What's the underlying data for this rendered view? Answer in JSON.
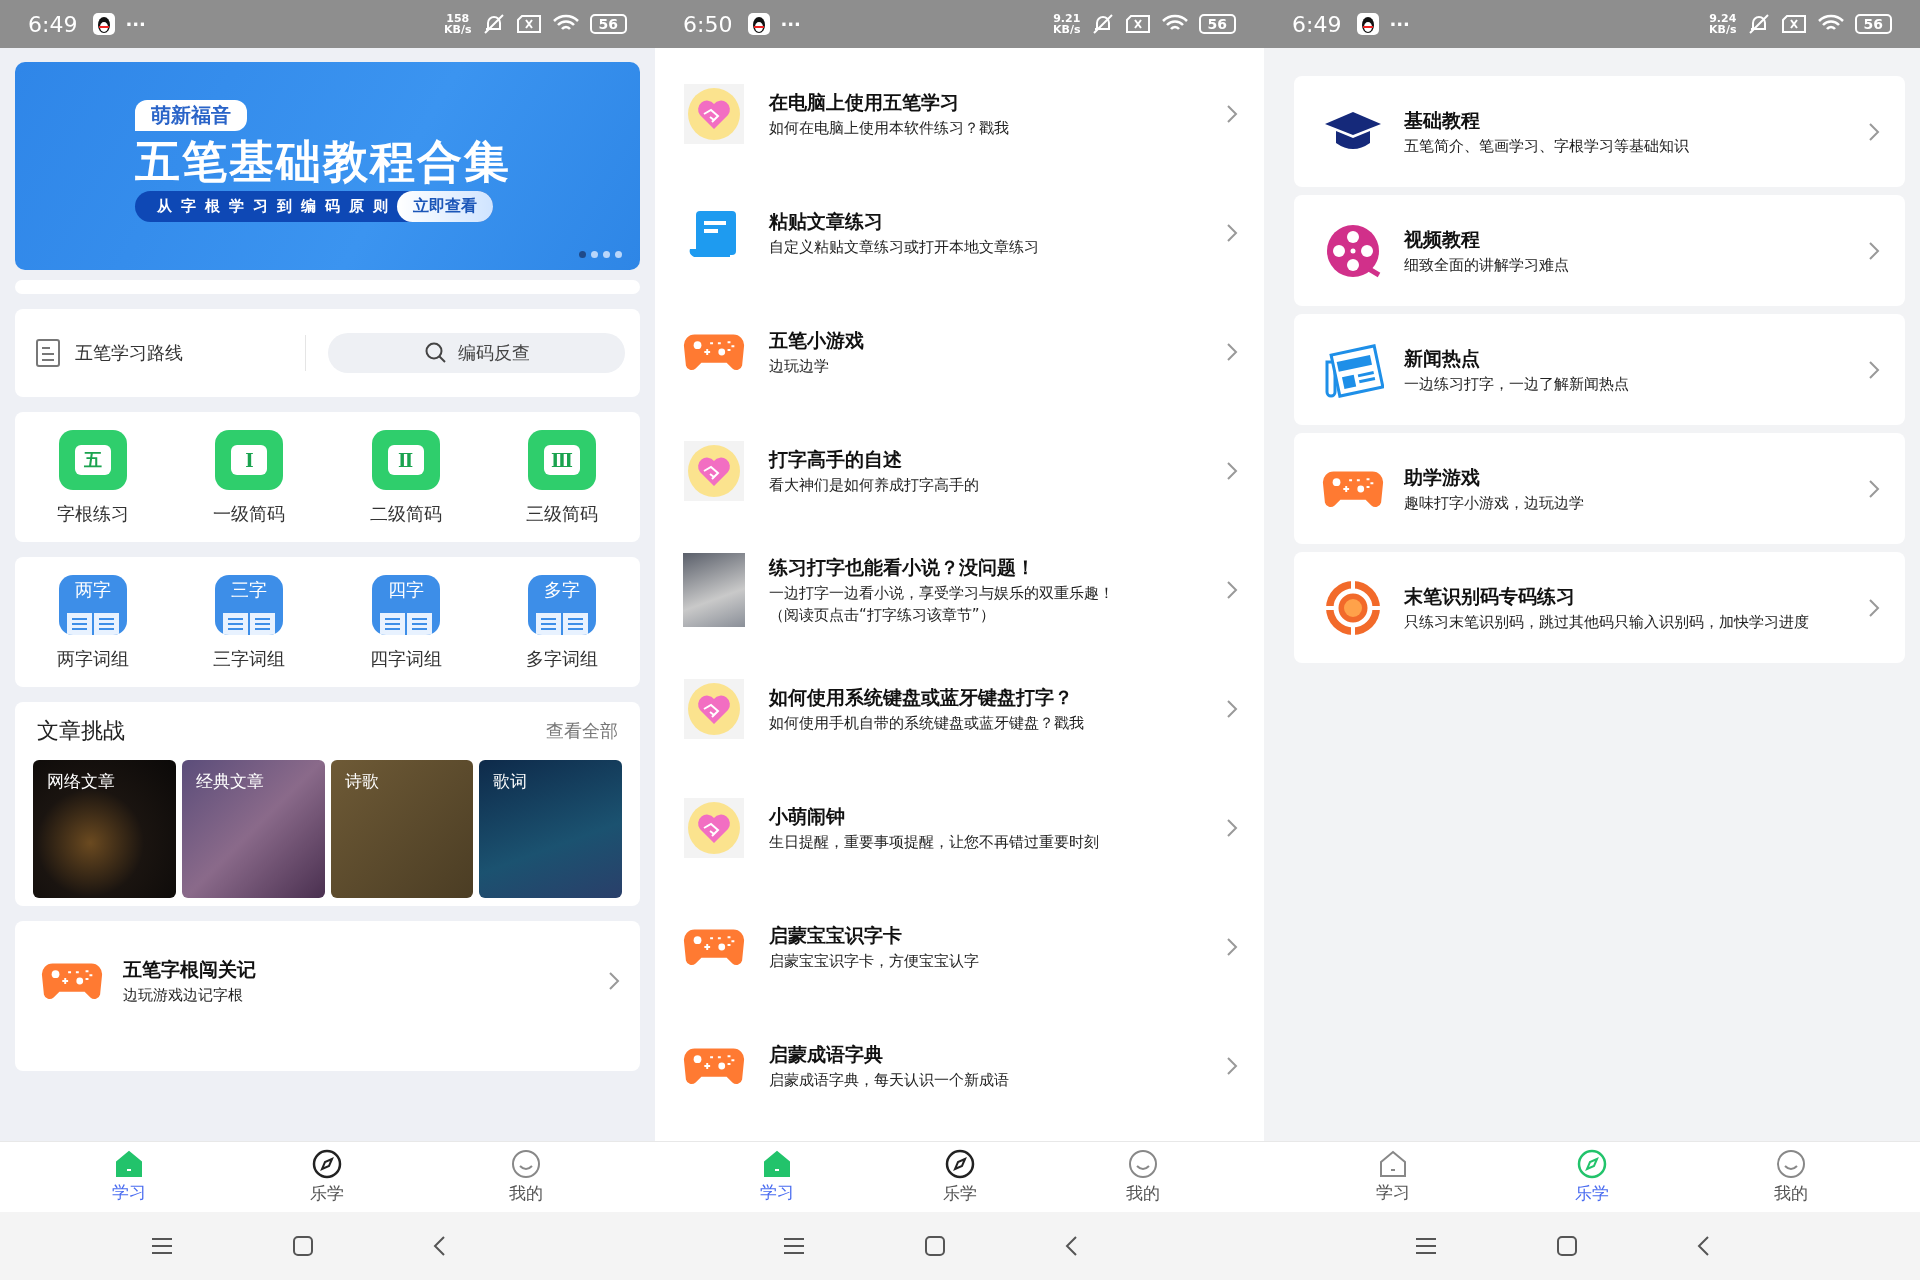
{
  "screens": [
    {
      "kind": "home",
      "status_bar": {
        "time": "6:49",
        "more": "···",
        "speed": "158",
        "speed_unit": "KB/s",
        "battery": "56"
      },
      "banner": {
        "tag": "萌新福音",
        "title": "五笔基础教程合集",
        "subtitle": "从字根学习到编码原则",
        "button": "立即查看",
        "dots": [
          {
            "selected": true
          },
          {
            "selected": false
          },
          {
            "selected": false
          },
          {
            "selected": false
          }
        ]
      },
      "route_link": "五笔学习路线",
      "search": {
        "placeholder": "编码反查"
      },
      "basics": [
        {
          "glyph": "五",
          "label": "字根练习"
        },
        {
          "glyph": "Ⅰ",
          "label": "一级简码"
        },
        {
          "glyph": "Ⅱ",
          "label": "二级简码"
        },
        {
          "glyph": "Ⅲ",
          "label": "三级简码"
        }
      ],
      "phrases": [
        {
          "tile": "两字",
          "label": "两字词组"
        },
        {
          "tile": "三字",
          "label": "三字词组"
        },
        {
          "tile": "四字",
          "label": "四字词组"
        },
        {
          "tile": "多字",
          "label": "多字词组"
        }
      ],
      "articles": {
        "title": "文章挑战",
        "more": "查看全部",
        "cards": [
          {
            "label": "网络文章"
          },
          {
            "label": "经典文章"
          },
          {
            "label": "诗歌"
          },
          {
            "label": "歌词"
          }
        ]
      },
      "items": [
        {
          "kind": "gamepad",
          "title": "五笔字根闯关记",
          "subtitle": "边玩游戏边记字根"
        }
      ],
      "tabs": [
        {
          "kind": "home",
          "label": "学习",
          "selected": true
        },
        {
          "kind": "compass",
          "label": "乐学",
          "selected": false
        },
        {
          "kind": "face",
          "label": "我的",
          "selected": false
        }
      ]
    },
    {
      "kind": "list",
      "status_bar": {
        "time": "6:50",
        "more": "···",
        "speed": "9.21",
        "speed_unit": "KB/s",
        "battery": "56"
      },
      "items": [
        {
          "kind": "heart",
          "title": "在电脑上使用五笔学习",
          "subtitle": "如何在电脑上使用本软件练习？戳我"
        },
        {
          "kind": "scroll",
          "title": "粘贴文章练习",
          "subtitle": "自定义粘贴文章练习或打开本地文章练习"
        },
        {
          "kind": "gamepad",
          "title": "五笔小游戏",
          "subtitle": "边玩边学"
        },
        {
          "kind": "heart",
          "title": "打字高手的自述",
          "subtitle": "看大神们是如何养成打字高手的"
        },
        {
          "kind": "cover",
          "title": "练习打字也能看小说？没问题！",
          "subtitle": "一边打字一边看小说，享受学习与娱乐的双重乐趣！",
          "subtitle_2": "（阅读页点击“打字练习该章节”）"
        },
        {
          "kind": "heart",
          "title": "如何使用系统键盘或蓝牙键盘打字？",
          "subtitle": "如何使用手机自带的系统键盘或蓝牙键盘？戳我"
        },
        {
          "kind": "heart",
          "title": "小萌闹钟",
          "subtitle": "生日提醒，重要事项提醒，让您不再错过重要时刻"
        },
        {
          "kind": "gamepad",
          "title": "启蒙宝宝识字卡",
          "subtitle": "启蒙宝宝识字卡，方便宝宝认字"
        },
        {
          "kind": "gamepad",
          "title": "启蒙成语字典",
          "subtitle": "启蒙成语字典，每天认识一个新成语"
        }
      ],
      "tabs": [
        {
          "kind": "home",
          "label": "学习",
          "selected": true
        },
        {
          "kind": "compass",
          "label": "乐学",
          "selected": false
        },
        {
          "kind": "face",
          "label": "我的",
          "selected": false
        }
      ]
    },
    {
      "kind": "cards",
      "status_bar": {
        "time": "6:49",
        "more": "···",
        "speed": "9.24",
        "speed_unit": "KB/s",
        "battery": "56"
      },
      "items": [
        {
          "kind": "cap",
          "title": "基础教程",
          "subtitle": "五笔简介、笔画学习、字根学习等基础知识"
        },
        {
          "kind": "film",
          "title": "视频教程",
          "subtitle": "细致全面的讲解学习难点"
        },
        {
          "kind": "news",
          "title": "新闻热点",
          "subtitle": "一边练习打字，一边了解新闻热点"
        },
        {
          "kind": "gamepad",
          "title": "助学游戏",
          "subtitle": "趣味打字小游戏，边玩边学"
        },
        {
          "kind": "target",
          "title": "末笔识别码专码练习",
          "subtitle": "只练习末笔识别码，跳过其他码只输入识别码，加快学习进度"
        }
      ],
      "tabs": [
        {
          "kind": "home",
          "label": "学习",
          "selected": false
        },
        {
          "kind": "compass",
          "label": "乐学",
          "selected": true
        },
        {
          "kind": "face",
          "label": "我的",
          "selected": false
        }
      ]
    }
  ]
}
